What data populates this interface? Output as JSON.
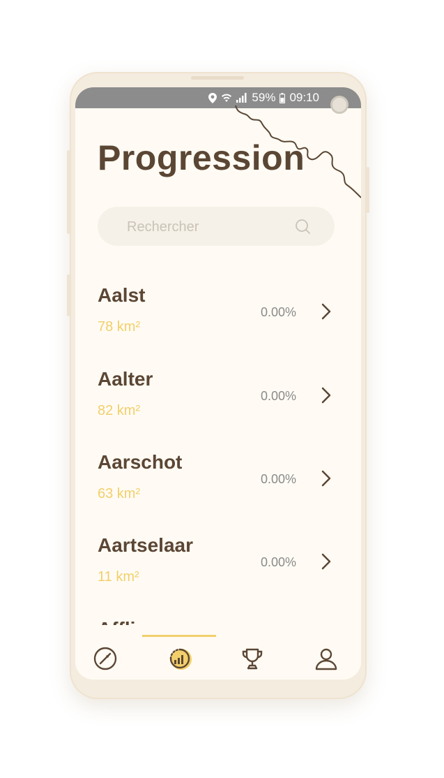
{
  "status_bar": {
    "battery": "59%",
    "time": "09:10"
  },
  "page": {
    "title": "Progression"
  },
  "search": {
    "placeholder": "Rechercher"
  },
  "list": [
    {
      "name": "Aalst",
      "area": "78 km²",
      "progress": "0.00%"
    },
    {
      "name": "Aalter",
      "area": "82 km²",
      "progress": "0.00%"
    },
    {
      "name": "Aarschot",
      "area": "63 km²",
      "progress": "0.00%"
    },
    {
      "name": "Aartselaar",
      "area": "11 km²",
      "progress": "0.00%"
    },
    {
      "name": "Affligem",
      "area": "",
      "progress": ""
    }
  ],
  "nav": {
    "items": [
      {
        "icon": "compass-icon",
        "active": false
      },
      {
        "icon": "progress-chart-icon",
        "active": true
      },
      {
        "icon": "trophy-icon",
        "active": false
      },
      {
        "icon": "profile-icon",
        "active": false
      }
    ]
  },
  "colors": {
    "brown": "#5b4634",
    "accent_yellow": "#f2cf6b",
    "background": "#fffbf4"
  }
}
